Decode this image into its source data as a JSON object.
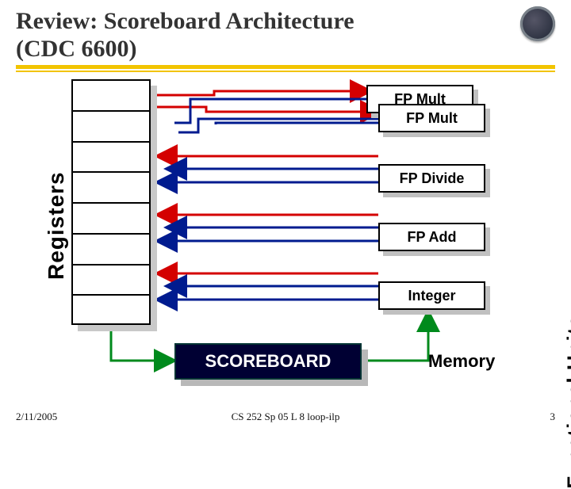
{
  "title_line1": "Review: Scoreboard Architecture",
  "title_line2": "(CDC 6600)",
  "labels": {
    "registers": "Registers",
    "functional_units": "Functional Units",
    "memory": "Memory",
    "scoreboard": "SCOREBOARD"
  },
  "fu_boxes": [
    "FP Mult",
    "FP Mult",
    "FP Divide",
    "FP Add",
    "Integer"
  ],
  "footer": {
    "date": "2/11/2005",
    "center": "CS 252 Sp 05  L 8 loop-ilp",
    "page": "3"
  },
  "colors": {
    "red": "#d40000",
    "blue": "#001b8f",
    "green": "#008a1c"
  }
}
